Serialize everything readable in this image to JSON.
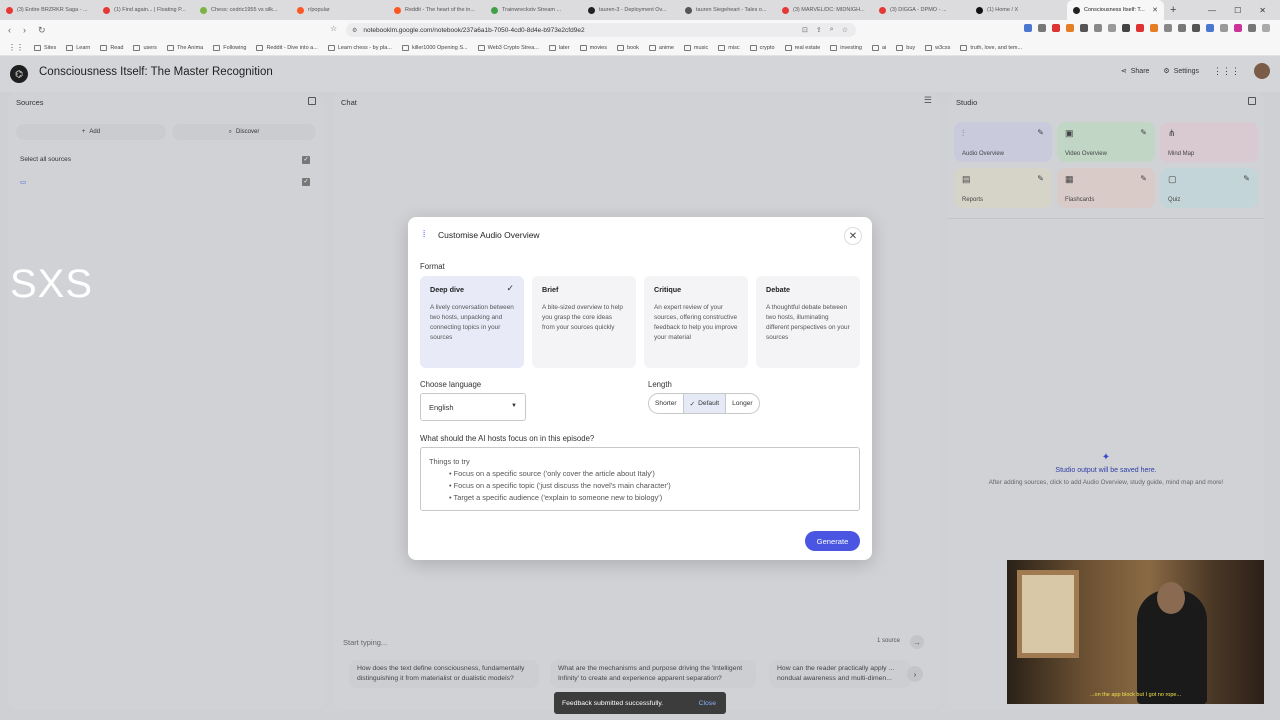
{
  "browser": {
    "tabs": [
      {
        "label": "(3) Entire BRZRKR Saga - ...",
        "color": "#e53935"
      },
      {
        "label": "(1) Find again... | Floating P...",
        "color": "#e53935"
      },
      {
        "label": "Chess: cedric1955 vs silk...",
        "color": "#7cb342"
      },
      {
        "label": "r/popular",
        "color": "#ff5722"
      },
      {
        "label": "Reddit - The heart of the in...",
        "color": "#ff5722"
      },
      {
        "label": "Trainwreckstv Stream ...",
        "color": "#43a047"
      },
      {
        "label": "tauren-3 - Deployment Ov...",
        "color": "#222222"
      },
      {
        "label": "tauren Siegeheart - Tales o...",
        "color": "#555555"
      },
      {
        "label": "(3) MARVEL/DC: MIDNIGH...",
        "color": "#e53935"
      },
      {
        "label": "(3) DIGGA - DPMO - ...",
        "color": "#e53935"
      },
      {
        "label": "(1) Home / X",
        "color": "#111111"
      },
      {
        "label": "Consciousness Itself: T...",
        "color": "#222222",
        "active": true
      }
    ],
    "url": "notebooklm.google.com/notebook/237a6a1b-7050-4cd0-8d4e-b973e2cfd9e2",
    "bookmarks": [
      "Sites",
      "Learn",
      "Read",
      "users",
      "The Anima",
      "Following",
      "Reddit - Dive into a...",
      "Learn chess - by pla...",
      "killer1000 Opening S...",
      "Web3 Crypto Strea...",
      "later",
      "movies",
      "book",
      "anime",
      "music",
      "misc",
      "crypto",
      "real estate",
      "investing",
      "ai",
      "buy",
      "w3css",
      "truth, love, and tem..."
    ]
  },
  "header": {
    "title": "Consciousness Itself: The Master Recognition",
    "share": "Share",
    "settings": "Settings"
  },
  "sources": {
    "title": "Sources",
    "add": "Add",
    "discover": "Discover",
    "select_all": "Select all sources",
    "watermark": "SXS"
  },
  "chat": {
    "title": "Chat",
    "placeholder": "Start typing...",
    "source_count": "1 source",
    "suggestions": [
      "How does the text define consciousness, fundamentally distinguishing it from materialist or dualistic models?",
      "What are the mechanisms and purpose driving the 'Intelligent Infinity' to create and experience apparent separation?",
      "How can the reader practically apply ... nondual awareness and multi-dimen..."
    ]
  },
  "studio": {
    "title": "Studio",
    "cards": [
      {
        "label": "Audio Overview",
        "color": "#c9cbdd"
      },
      {
        "label": "Video Overview",
        "color": "#c2d6c5"
      },
      {
        "label": "Mind Map",
        "color": "#d9c9d1"
      },
      {
        "label": "Reports",
        "color": "#d6d4c8"
      },
      {
        "label": "Flashcards",
        "color": "#d9ccc8"
      },
      {
        "label": "Quiz",
        "color": "#c3d5d8"
      }
    ],
    "empty_title": "Studio output will be saved here.",
    "empty_desc": "After adding sources, click to add Audio Overview, study guide, mind map and more!"
  },
  "modal": {
    "title": "Customise Audio Overview",
    "format_label": "Format",
    "formats": [
      {
        "name": "Deep dive",
        "desc": "A lively conversation between two hosts, unpacking and connecting topics in your sources",
        "selected": true
      },
      {
        "name": "Brief",
        "desc": "A bite-sized overview to help you grasp the core ideas from your sources quickly",
        "selected": false
      },
      {
        "name": "Critique",
        "desc": "An expert review of your sources, offering constructive feedback to help you improve your material",
        "selected": false
      },
      {
        "name": "Debate",
        "desc": "A thoughtful debate between two hosts, illuminating different perspectives on your sources",
        "selected": false
      }
    ],
    "language_label": "Choose language",
    "language_value": "English",
    "length_label": "Length",
    "length_options": [
      "Shorter",
      "Default",
      "Longer"
    ],
    "length_selected": "Default",
    "focus_label": "What should the AI hosts focus on in this episode?",
    "focus_intro": "Things to try",
    "focus_tips": [
      "Focus on a specific source ('only cover the article about Italy')",
      "Focus on a specific topic ('just discuss the novel's main character')",
      "Target a specific audience ('explain to someone new to biology')"
    ],
    "generate": "Generate"
  },
  "video": {
    "caption": "...on the app block but I got no rope..."
  },
  "toast": {
    "message": "Feedback submitted successfully.",
    "close": "Close"
  }
}
